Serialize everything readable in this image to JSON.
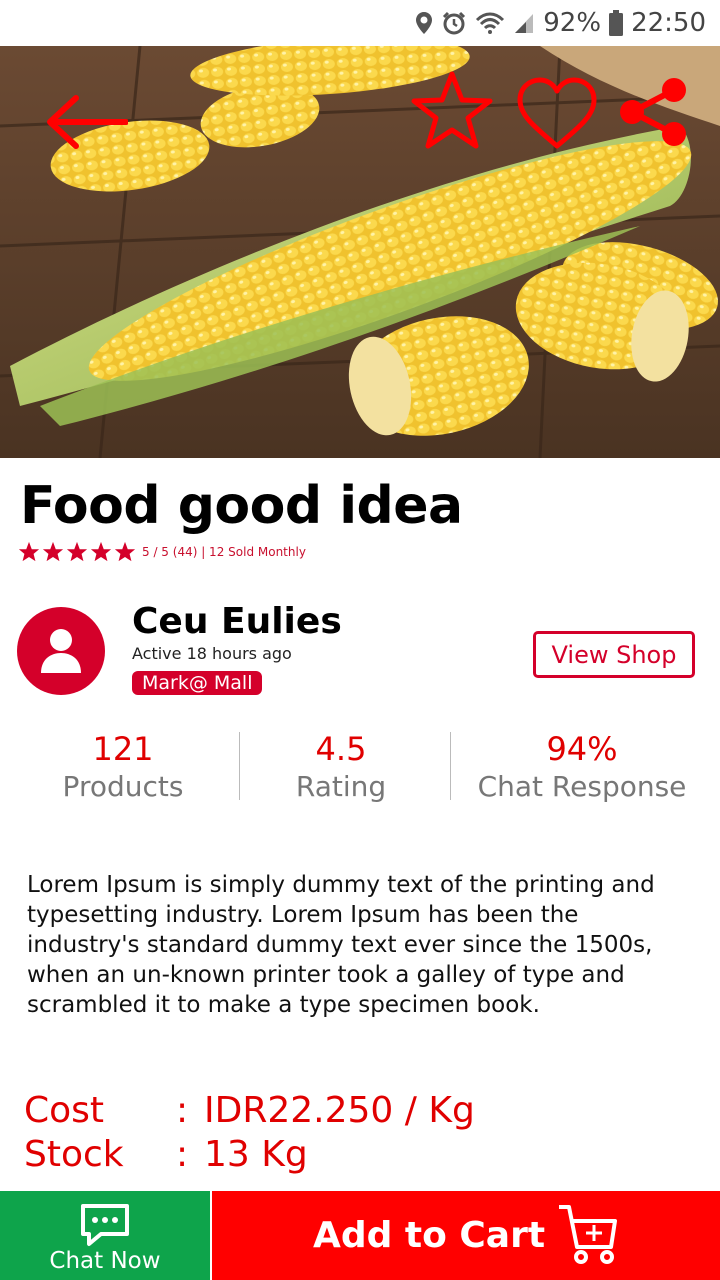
{
  "status_bar": {
    "battery": "92%",
    "time": "22:50",
    "icons": [
      "location-icon",
      "alarm-icon",
      "wifi-icon",
      "signal-icon",
      "battery-icon"
    ]
  },
  "hero": {
    "icons": [
      "back-arrow-icon",
      "star-outline-icon",
      "heart-outline-icon",
      "share-icon"
    ],
    "accent_color": "#ff0000"
  },
  "product": {
    "title": "Food good idea",
    "stars": 5,
    "rating_text": "5 / 5 (44) | 12 Sold Monthly"
  },
  "seller": {
    "name": "Ceu Eulies",
    "active": "Active 18 hours ago",
    "badge": "Mark@ Mall",
    "view_shop_label": "View Shop"
  },
  "stats": [
    {
      "value": "121",
      "label": "Products"
    },
    {
      "value": "4.5",
      "label": "Rating"
    },
    {
      "value": "94%",
      "label": "Chat Response"
    }
  ],
  "description": "Lorem Ipsum is simply dummy text of the printing and typesetting industry. Lorem Ipsum has been the industry's standard dummy text ever since the 1500s, when an un-known printer took a galley of type and scrambled it to make a type specimen book.",
  "pricing": {
    "cost_label": "Cost",
    "cost_value": "IDR22.250 / Kg",
    "stock_label": "Stock",
    "stock_value": "13 Kg",
    "colon": ":"
  },
  "actions": {
    "chat_label": "Chat Now",
    "cart_label": "Add to Cart"
  },
  "colors": {
    "primary_red": "#e00000",
    "badge_red": "#d4002a",
    "chat_green": "#0ea44b",
    "cart_red": "#ff0000"
  }
}
